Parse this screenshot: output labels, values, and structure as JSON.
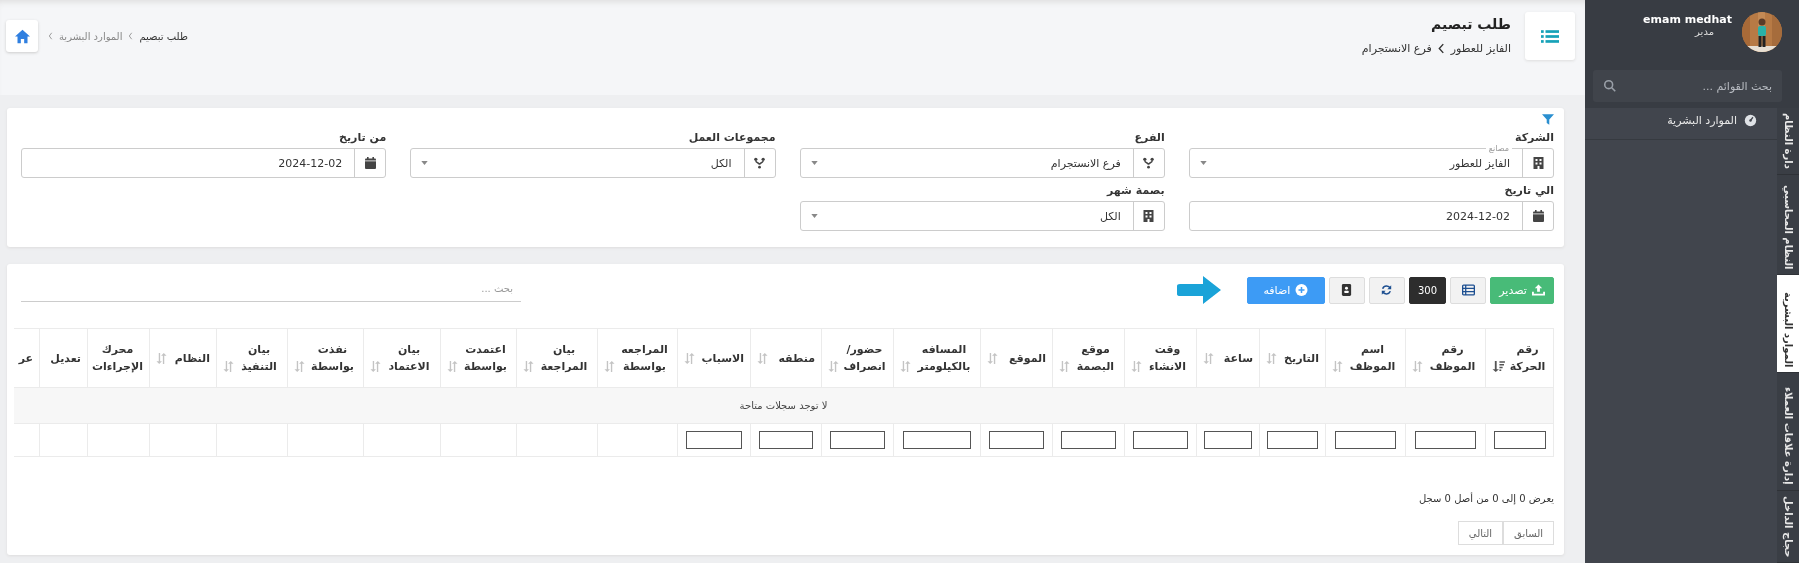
{
  "sidebar": {
    "user": {
      "name": "emam medhat",
      "role": "مدير"
    },
    "search": {
      "placeholder": "بحث القوائم ..."
    },
    "items": [
      {
        "label": "الموارد البشرية"
      }
    ],
    "vertical_tabs": [
      {
        "label": "دارة النظام",
        "selected": false
      },
      {
        "label": "النظام المحاسبي",
        "selected": false
      },
      {
        "label": "الموارد البشرية",
        "selected": true
      },
      {
        "label": "إدارة علاقات العملاء",
        "selected": false
      },
      {
        "label": "حجاج الداخل",
        "selected": false
      }
    ]
  },
  "header": {
    "title": "طلب تبصيم",
    "path": [
      "الفايز للعطور",
      "فرع الانستجرام"
    ]
  },
  "breadcrumb": [
    "طلب تبصيم",
    "الموارد البشرية"
  ],
  "filters": [
    [
      {
        "label": "الشركة",
        "kind": "building",
        "floating_label": "مصانع",
        "value": "الفايز للعطور"
      },
      {
        "label": "الفرع",
        "kind": "fork",
        "value": "فرع الانستجرام"
      },
      {
        "label": "مجموعات العمل",
        "kind": "fork",
        "value": "الكل"
      },
      {
        "label": "من تاريخ",
        "kind": "date",
        "value": "2024-12-02"
      }
    ],
    [
      {
        "label": "الي تاريخ",
        "kind": "date",
        "value": "2024-12-02"
      },
      {
        "label": "بصمة شهر",
        "kind": "building",
        "value": "الكل"
      }
    ]
  ],
  "toolbar": {
    "buttons": [
      {
        "kind": "export",
        "label": "تصدير"
      },
      {
        "kind": "columns"
      },
      {
        "kind": "page-size",
        "label": "300"
      },
      {
        "kind": "refresh"
      },
      {
        "kind": "contact"
      },
      {
        "kind": "add",
        "label": "اضافه"
      }
    ],
    "search": {
      "placeholder": "بحث ..."
    }
  },
  "table": {
    "columns": [
      {
        "label": "رقم الحركة",
        "sortable": true,
        "sorted": true,
        "filterable": true
      },
      {
        "label": "رقم الموظف",
        "sortable": true,
        "sorted": false,
        "filterable": true
      },
      {
        "label": "اسم الموظف",
        "sortable": true,
        "sorted": false,
        "filterable": true
      },
      {
        "label": "التاريخ",
        "sortable": true,
        "sorted": false,
        "filterable": true
      },
      {
        "label": "ساعة",
        "sortable": true,
        "sorted": false,
        "filterable": true
      },
      {
        "label": "وقت الانشاء",
        "sortable": true,
        "sorted": false,
        "filterable": true
      },
      {
        "label": "موقع البصمة",
        "sortable": true,
        "sorted": false,
        "filterable": true
      },
      {
        "label": "الموقع",
        "sortable": true,
        "sorted": false,
        "filterable": true
      },
      {
        "label": "المسافه بالكيلومتر",
        "sortable": true,
        "sorted": false,
        "filterable": true
      },
      {
        "label": "حضور/ انصراف",
        "sortable": true,
        "sorted": false,
        "filterable": true
      },
      {
        "label": "منطقه",
        "sortable": true,
        "sorted": false,
        "filterable": true
      },
      {
        "label": "الاسباب",
        "sortable": true,
        "sorted": false,
        "filterable": true
      },
      {
        "label": "المراجعه بواسطة",
        "sortable": true,
        "sorted": false,
        "filterable": false
      },
      {
        "label": "بيان المراجعة",
        "sortable": true,
        "sorted": false,
        "filterable": false
      },
      {
        "label": "اعتمدت بواسطة",
        "sortable": true,
        "sorted": false,
        "filterable": false
      },
      {
        "label": "بيان الاعتماد",
        "sortable": true,
        "sorted": false,
        "filterable": false
      },
      {
        "label": "نفذت بواسطة",
        "sortable": true,
        "sorted": false,
        "filterable": false
      },
      {
        "label": "بيان التنفيذ",
        "sortable": true,
        "sorted": false,
        "filterable": false
      },
      {
        "label": "النظام",
        "sortable": true,
        "sorted": false,
        "filterable": false
      },
      {
        "label": "محرك الإجراءات",
        "sortable": false,
        "sorted": false,
        "filterable": false
      },
      {
        "label": "تعديل",
        "sortable": false,
        "sorted": false,
        "filterable": false
      },
      {
        "label": "عر",
        "sortable": false,
        "sorted": false,
        "filterable": false
      }
    ],
    "empty_message": "لا توجد سجلات متاحة"
  },
  "footer": {
    "info": "يعرض 0 إلى 0 من أصل 0 سجل",
    "pagination": [
      "السابق",
      "التالي"
    ]
  }
}
